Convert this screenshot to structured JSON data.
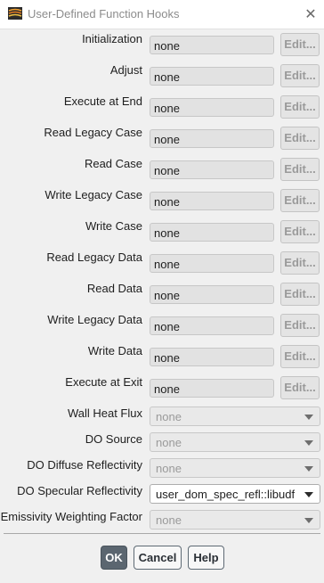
{
  "window": {
    "title": "User-Defined Function Hooks",
    "close_icon": "close-icon",
    "app_icon": "fluent-app-icon"
  },
  "hooks": [
    {
      "label": "Initialization",
      "value": "none",
      "button": "Edit..."
    },
    {
      "label": "Adjust",
      "value": "none",
      "button": "Edit..."
    },
    {
      "label": "Execute at End",
      "value": "none",
      "button": "Edit..."
    },
    {
      "label": "Read Legacy Case",
      "value": "none",
      "button": "Edit..."
    },
    {
      "label": "Read Case",
      "value": "none",
      "button": "Edit..."
    },
    {
      "label": "Write Legacy Case",
      "value": "none",
      "button": "Edit..."
    },
    {
      "label": "Write Case",
      "value": "none",
      "button": "Edit..."
    },
    {
      "label": "Read Legacy Data",
      "value": "none",
      "button": "Edit..."
    },
    {
      "label": "Read Data",
      "value": "none",
      "button": "Edit..."
    },
    {
      "label": "Write Legacy Data",
      "value": "none",
      "button": "Edit..."
    },
    {
      "label": "Write Data",
      "value": "none",
      "button": "Edit..."
    },
    {
      "label": "Execute at Exit",
      "value": "none",
      "button": "Edit..."
    }
  ],
  "dropdowns": [
    {
      "label": "Wall Heat Flux",
      "value": "none",
      "enabled": false
    },
    {
      "label": "DO Source",
      "value": "none",
      "enabled": false
    },
    {
      "label": "DO Diffuse Reflectivity",
      "value": "none",
      "enabled": false
    },
    {
      "label": "DO Specular Reflectivity",
      "value": "user_dom_spec_refl::libudf",
      "enabled": true
    },
    {
      "label": "Emissivity Weighting Factor",
      "value": "none",
      "enabled": false
    }
  ],
  "buttons": {
    "ok": "OK",
    "cancel": "Cancel",
    "help": "Help"
  },
  "colors": {
    "ok_background": "#5b6670",
    "disabled_text": "#9a9a9a"
  }
}
